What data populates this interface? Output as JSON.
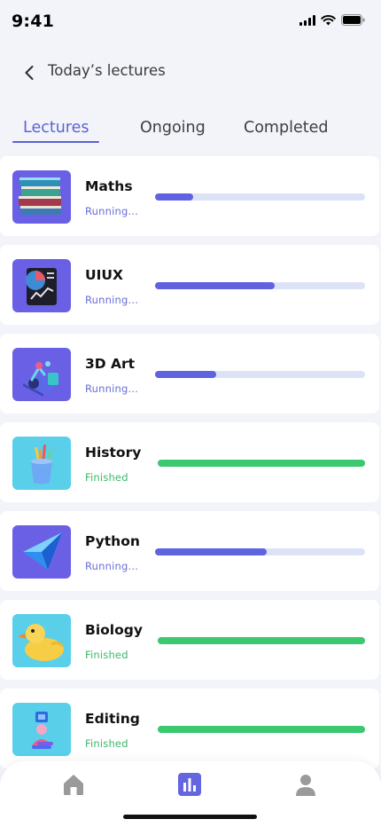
{
  "status_bar": {
    "time": "9:41"
  },
  "header": {
    "title": "Today’s lectures"
  },
  "tabs": [
    {
      "label": "Lectures",
      "active": true
    },
    {
      "label": "Ongoing",
      "active": false
    },
    {
      "label": "Completed",
      "active": false
    }
  ],
  "lectures": [
    {
      "name": "Maths",
      "status": "Running...",
      "progress": 0.18,
      "thumb_bg": "#6A60E6",
      "icon": "books-icon"
    },
    {
      "name": "UIUX",
      "status": "Running...",
      "progress": 0.57,
      "thumb_bg": "#6A60E6",
      "icon": "chart-document-icon"
    },
    {
      "name": "3D Art",
      "status": "Running...",
      "progress": 0.29,
      "thumb_bg": "#6A60E6",
      "icon": "3d-scene-icon"
    },
    {
      "name": "History",
      "status": "Finished",
      "progress": 1.0,
      "thumb_bg": "#5ACFEA",
      "icon": "pencil-cup-icon"
    },
    {
      "name": "Python",
      "status": "Running...",
      "progress": 0.53,
      "thumb_bg": "#6A60E6",
      "icon": "geometric-shape-icon"
    },
    {
      "name": "Biology",
      "status": "Finished",
      "progress": 1.0,
      "thumb_bg": "#5ACFEA",
      "icon": "rubber-duck-icon"
    },
    {
      "name": "Editing",
      "status": "Finished",
      "progress": 1.0,
      "thumb_bg": "#5ACFEA",
      "icon": "editing-figure-icon"
    }
  ],
  "nav": [
    {
      "icon": "home-icon",
      "active": false
    },
    {
      "icon": "chart-icon",
      "active": true
    },
    {
      "icon": "profile-icon",
      "active": false
    }
  ],
  "colors": {
    "accent": "#5A63D6",
    "running_bar": "#5F63E0",
    "finished_bar": "#3CC86E",
    "track": "#DDE3F7",
    "running_text": "#6A6FD6",
    "finished_text": "#3CB868"
  }
}
